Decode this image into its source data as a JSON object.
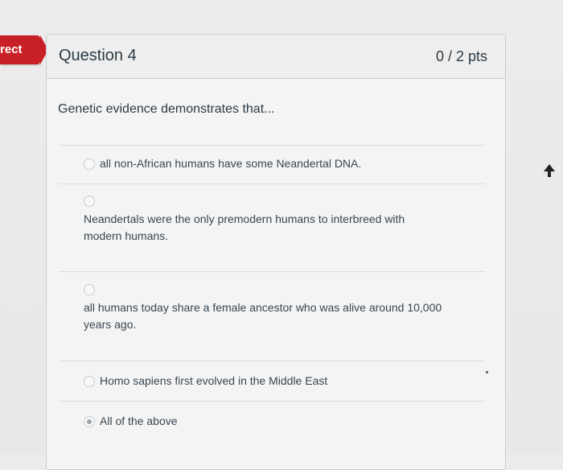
{
  "status_tag": {
    "label": "rect"
  },
  "question": {
    "title": "Question 4",
    "points": "0 / 2 pts",
    "prompt": "Genetic evidence demonstrates that..."
  },
  "answers": [
    {
      "text": "all non-African humans have some Neandertal DNA.",
      "selected": false
    },
    {
      "line1": "Neandertals were the only premodern humans to interbreed with",
      "line2": "modern humans.",
      "selected": false
    },
    {
      "line1": "all humans today share a female ancestor who was alive around 10,000",
      "line2": "years ago.",
      "selected": false
    },
    {
      "text": "Homo sapiens first evolved in the Middle East",
      "selected": false
    },
    {
      "text": "All of the above",
      "selected": true
    }
  ],
  "colors": {
    "tag_red": "#c91f26",
    "text": "#2d3b45",
    "border": "#c7cdd1"
  }
}
